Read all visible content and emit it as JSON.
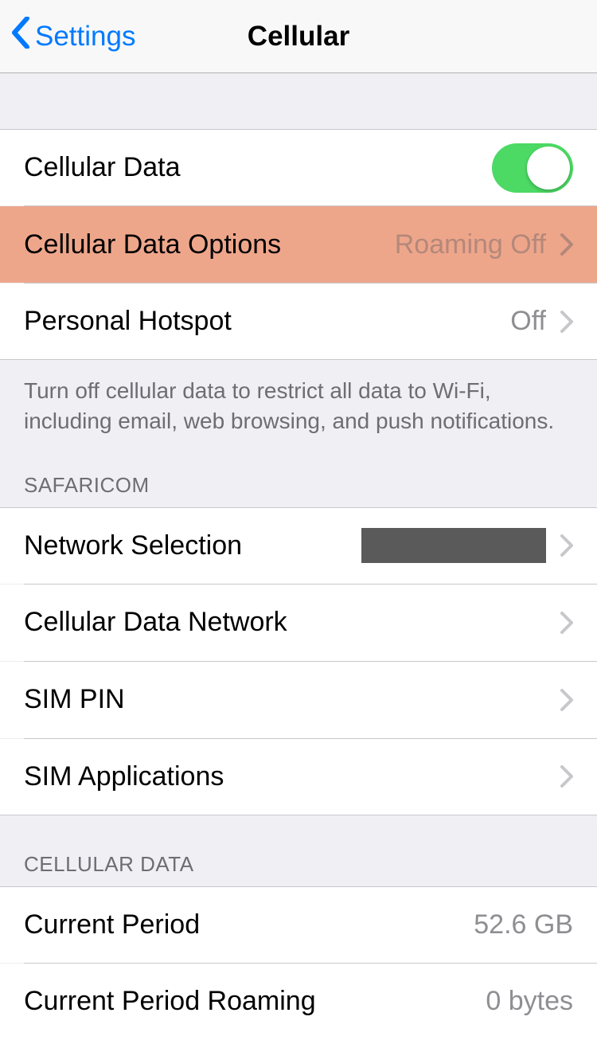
{
  "nav": {
    "back_label": "Settings",
    "title": "Cellular"
  },
  "group1": {
    "cellular_data_label": "Cellular Data",
    "cellular_data_options_label": "Cellular Data Options",
    "cellular_data_options_value": "Roaming Off",
    "personal_hotspot_label": "Personal Hotspot",
    "personal_hotspot_value": "Off",
    "footer": "Turn off cellular data to restrict all data to Wi-Fi, including email, web browsing, and push notifications."
  },
  "carrier": {
    "header": "SAFARICOM",
    "network_selection_label": "Network Selection",
    "cellular_data_network_label": "Cellular Data Network",
    "sim_pin_label": "SIM PIN",
    "sim_applications_label": "SIM Applications"
  },
  "usage": {
    "header": "CELLULAR DATA",
    "current_period_label": "Current Period",
    "current_period_value": "52.6 GB",
    "current_period_roaming_label": "Current Period Roaming",
    "current_period_roaming_value": "0 bytes"
  }
}
